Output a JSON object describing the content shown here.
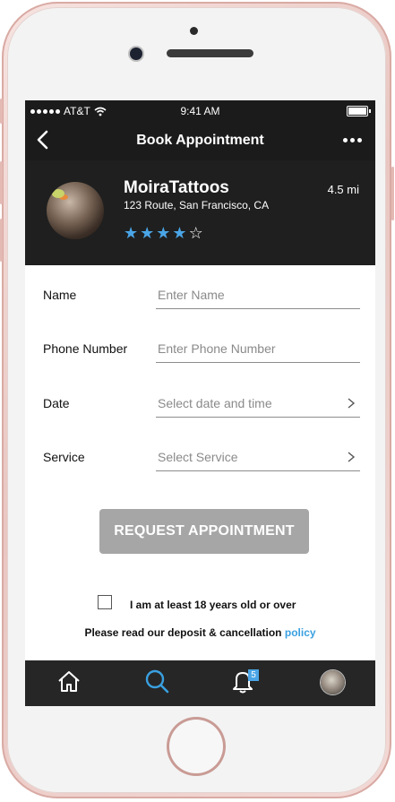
{
  "status_bar": {
    "carrier": "AT&T",
    "time": "9:41 AM"
  },
  "nav": {
    "title": "Book Appointment"
  },
  "profile": {
    "name": "MoiraTattoos",
    "address": "123 Route, San Francisco, CA",
    "distance": "4.5 mi",
    "rating": {
      "value": 4,
      "max": 5
    }
  },
  "form": {
    "name": {
      "label": "Name",
      "placeholder": "Enter Name"
    },
    "phone": {
      "label": "Phone Number",
      "placeholder": "Enter Phone Number"
    },
    "date": {
      "label": "Date",
      "placeholder": "Select date and time"
    },
    "service": {
      "label": "Service",
      "placeholder": "Select Service"
    }
  },
  "cta": {
    "label": "REQUEST APPOINTMENT"
  },
  "agreement": {
    "text": "I am at least 18 years old or over",
    "checked": false
  },
  "policy": {
    "text": "Please read our deposit & cancellation",
    "link": "policy"
  },
  "tabbar": {
    "items": [
      "home-icon",
      "search-icon",
      "bell-icon",
      "profile-avatar"
    ],
    "notification_count": "5"
  },
  "colors": {
    "accent": "#4aa5e6",
    "dark": "#1b1b1b",
    "button_disabled": "#a6a6a6"
  }
}
